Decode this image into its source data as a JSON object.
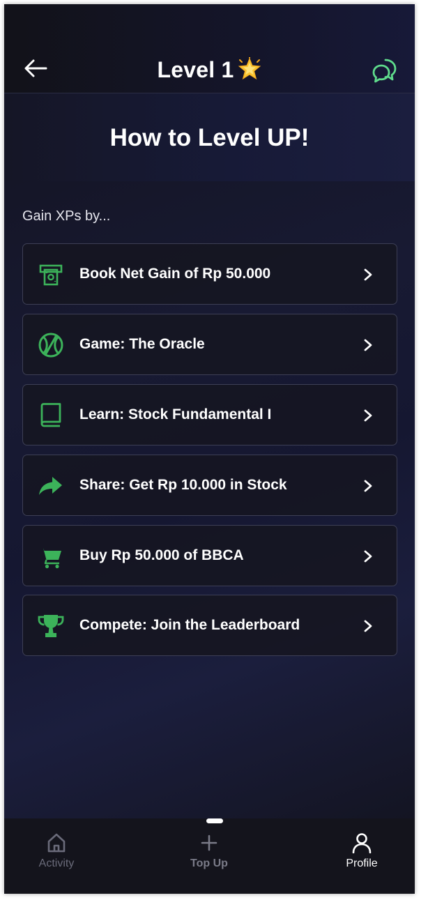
{
  "header": {
    "title": "Level 1",
    "back_icon": "arrow-left-icon",
    "star_icon": "glowing-star-icon",
    "chat_icon": "chat-bubbles-icon"
  },
  "hero": {
    "heading": "How to Level UP!"
  },
  "section": {
    "label": "Gain XPs by..."
  },
  "tasks": [
    {
      "icon": "banknote-icon",
      "label": "Book Net Gain of Rp 50.000"
    },
    {
      "icon": "tennis-ball-icon",
      "label": "Game: The Oracle"
    },
    {
      "icon": "book-icon",
      "label": "Learn: Stock Fundamental I"
    },
    {
      "icon": "share-arrow-icon",
      "label": "Share: Get Rp 10.000 in Stock"
    },
    {
      "icon": "shopping-cart-icon",
      "label": "Buy Rp 50.000 of BBCA"
    },
    {
      "icon": "trophy-icon",
      "label": "Compete: Join the Leaderboard"
    }
  ],
  "bottom_nav": {
    "items": [
      {
        "icon": "home-icon",
        "label": "Activity"
      },
      {
        "icon": "plus-icon",
        "label": "Top Up"
      },
      {
        "icon": "person-icon",
        "label": "Profile",
        "active": true
      }
    ]
  },
  "colors": {
    "accent_green": "#3cb35a",
    "chat_icon_green": "#5fdc8c",
    "card_border": "#3d3f55",
    "background_dark": "#13131d"
  }
}
